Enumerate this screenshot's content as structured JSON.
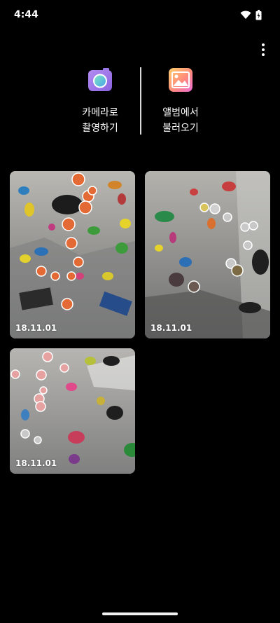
{
  "status_bar": {
    "time": "4:44",
    "wifi_icon": "wifi-icon",
    "battery_icon": "battery-icon"
  },
  "toolbar": {
    "more_icon": "more-vert-icon"
  },
  "actions": {
    "camera": {
      "label": "카메라로\n촬영하기",
      "icon": "camera-icon"
    },
    "album": {
      "label": "앨범에서\n불러오기",
      "icon": "gallery-icon"
    }
  },
  "photos": [
    {
      "date": "18.11.01"
    },
    {
      "date": "18.11.01"
    },
    {
      "date": "18.11.01"
    }
  ]
}
